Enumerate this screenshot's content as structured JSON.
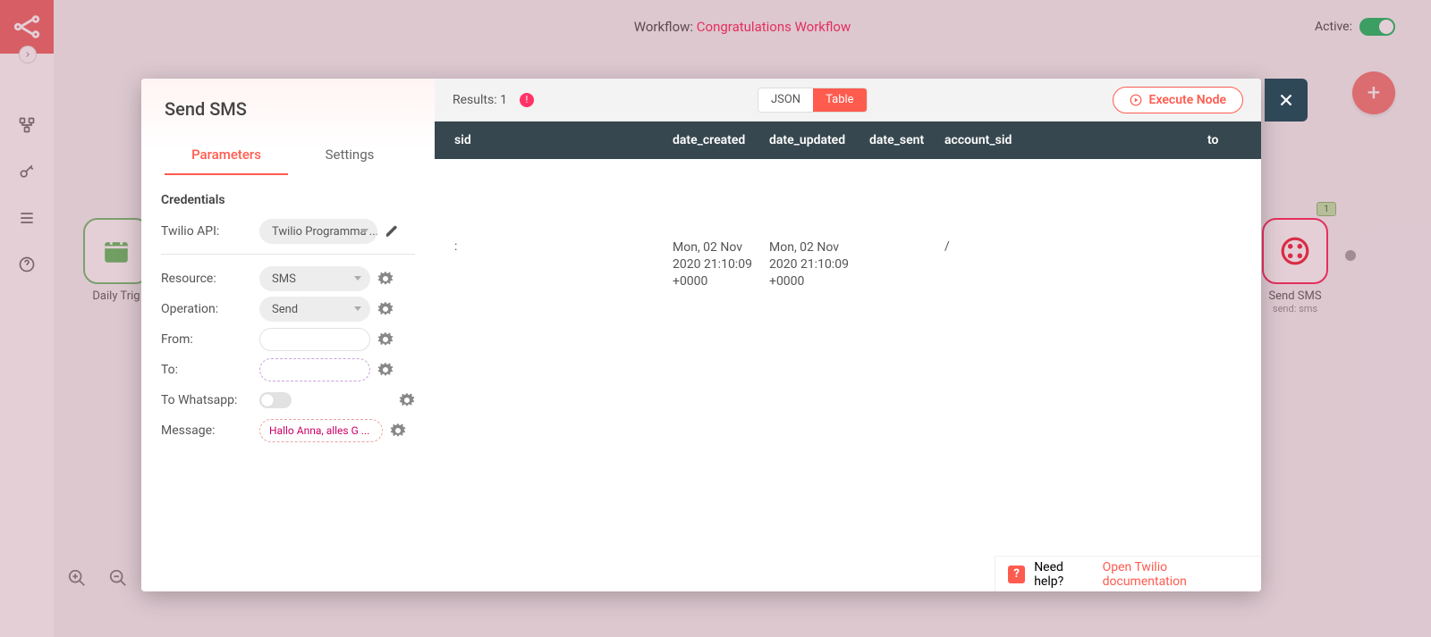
{
  "header": {
    "workflow_prefix": "Workflow:",
    "workflow_name": "Congratulations Workflow",
    "active_label": "Active:"
  },
  "bg_nodes": {
    "left": {
      "label": "Daily Trig"
    },
    "right": {
      "label": "Send SMS",
      "sub": "send: sms"
    }
  },
  "modal": {
    "title": "Send SMS",
    "tabs": {
      "parameters": "Parameters",
      "settings": "Settings"
    },
    "credentials_title": "Credentials",
    "rows": {
      "twilio_api": {
        "label": "Twilio API:",
        "value": "Twilio Programma ..."
      },
      "resource": {
        "label": "Resource:",
        "value": "SMS"
      },
      "operation": {
        "label": "Operation:",
        "value": "Send"
      },
      "from": {
        "label": "From:"
      },
      "to": {
        "label": "To:"
      },
      "to_whatsapp": {
        "label": "To Whatsapp:"
      },
      "message": {
        "label": "Message:",
        "value": "Hallo Anna,  alles G ..."
      }
    }
  },
  "results": {
    "label": "Results: 1",
    "view_json": "JSON",
    "view_table": "Table",
    "execute": "Execute Node",
    "columns": {
      "sid": "sid",
      "date_created": "date_created",
      "date_updated": "date_updated",
      "date_sent": "date_sent",
      "account_sid": "account_sid",
      "to": "to"
    },
    "row": {
      "sid": ":",
      "date_created": "Mon, 02 Nov 2020 21:10:09 +0000",
      "date_updated": "Mon, 02 Nov 2020 21:10:09 +0000",
      "date_sent": "",
      "account_sid": "/",
      "to": ""
    }
  },
  "help": {
    "text": "Need help?",
    "link": "Open Twilio documentation"
  }
}
